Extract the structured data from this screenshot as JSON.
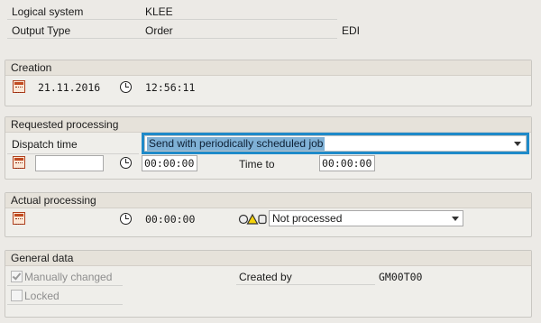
{
  "header": {
    "logical_system_label": "Logical system",
    "logical_system_value": "KLEE",
    "output_type_label": "Output Type",
    "output_type_value": "Order",
    "output_medium": "EDI"
  },
  "creation": {
    "title": "Creation",
    "date": "21.11.2016",
    "time": "12:56:11",
    "icons": [
      "calendar-icon",
      "clock-icon"
    ]
  },
  "requested_processing": {
    "title": "Requested processing",
    "dispatch_time_label": "Dispatch time",
    "dispatch_time_value": "Send with periodically scheduled job",
    "date_value": "",
    "time_from": "00:00:00",
    "time_to_label": "Time to",
    "time_to": "00:00:00"
  },
  "actual_processing": {
    "title": "Actual processing",
    "time": "00:00:00",
    "status_value": "Not processed",
    "status_colors": {
      "red": "#e0e0e0",
      "yellow": "#f5d20a",
      "green": "#e0e0e0"
    }
  },
  "general_data": {
    "title": "General data",
    "manually_changed_label": "Manually changed",
    "manually_changed_checked": true,
    "locked_label": "Locked",
    "locked_checked": false,
    "created_by_label": "Created by",
    "created_by_value": "GM00T00"
  },
  "colors": {
    "focus_border": "#1f8ac9",
    "selection": "#7fb1d6",
    "calendar_icon": "#c14a20"
  }
}
